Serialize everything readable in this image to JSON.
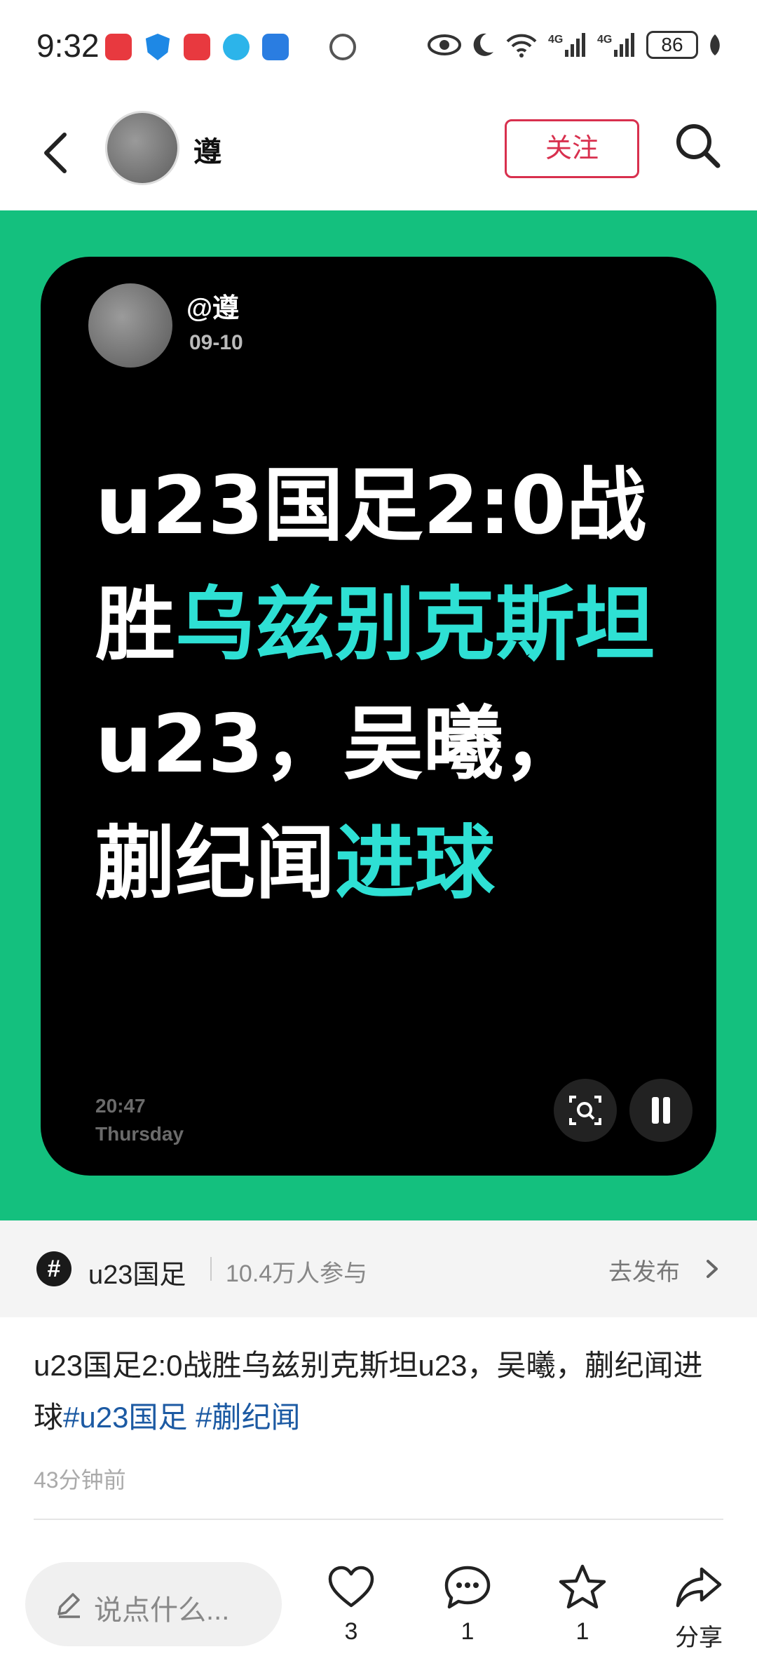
{
  "status_bar": {
    "time": "9:32",
    "battery": "86",
    "icons": [
      "eye-icon",
      "moon-icon",
      "wifi-icon",
      "signal-4g-icon",
      "signal-4g-icon",
      "leaf-icon"
    ]
  },
  "header": {
    "username": "遵",
    "follow_label": "关注"
  },
  "card": {
    "user": "@遵",
    "date": "09-10",
    "headline_parts": [
      {
        "text": "u23国足2:0战胜",
        "highlight": false
      },
      {
        "text": "乌兹别克斯坦",
        "highlight": true
      },
      {
        "text": "u23，吴曦，蒯纪闻",
        "highlight": false
      },
      {
        "text": "进球",
        "highlight": true
      }
    ],
    "time": "20:47",
    "day": "Thursday",
    "highlight_color": "#2ee0d4",
    "background_color": "#14c07e"
  },
  "topic": {
    "name": "u23国足",
    "participants": "10.4万人参与",
    "publish_label": "去发布"
  },
  "post": {
    "text": "u23国足2:0战胜乌兹别克斯坦u23，吴曦，蒯纪闻进球",
    "tags": [
      "#u23国足",
      "#蒯纪闻"
    ],
    "time": "43分钟前"
  },
  "bottom_bar": {
    "comment_placeholder": "说点什么...",
    "likes": "3",
    "comments": "1",
    "favorites": "1",
    "share_label": "分享"
  }
}
